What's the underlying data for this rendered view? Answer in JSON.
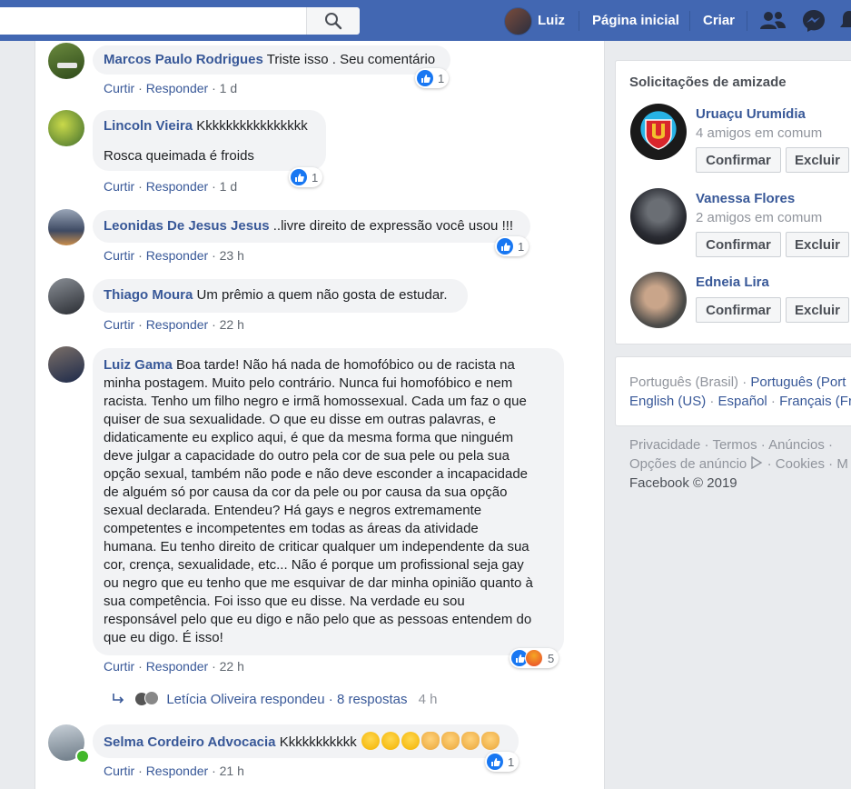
{
  "topbar": {
    "user_name": "Luiz",
    "home_label": "Página inicial",
    "create_label": "Criar",
    "colors": {
      "bar": "#4267b2"
    }
  },
  "comments": [
    {
      "author": "Marcos Paulo Rodrigues",
      "text": "Triste isso . Seu comentário",
      "like": "Curtir",
      "reply": "Responder",
      "time": "1 d",
      "reactions": "1"
    },
    {
      "author": "Lincoln Vieira",
      "text": "Kkkkkkkkkkkkkkkk",
      "text2": "Rosca queimada é froids",
      "like": "Curtir",
      "reply": "Responder",
      "time": "1 d",
      "reactions": "1"
    },
    {
      "author": "Leonidas De Jesus Jesus",
      "text": "..livre direito de expressão você usou !!!",
      "like": "Curtir",
      "reply": "Responder",
      "time": "23 h",
      "reactions": "1"
    },
    {
      "author": "Thiago Moura",
      "text": "Um prêmio a quem não gosta de estudar.",
      "like": "Curtir",
      "reply": "Responder",
      "time": "22 h"
    },
    {
      "author": "Luiz Gama",
      "text_lines": [
        "Boa tarde! Não há nada de homofóbico ou de racista na",
        "minha postagem. Muito pelo contrário. Nunca fui homofóbico e nem",
        "racista. Tenho um filho negro e irmã homossexual. Cada um faz o que",
        "quiser de sua sexualidade. O que eu disse em outras palavras, e",
        "didaticamente eu explico aqui, é que da mesma forma que ninguém",
        "deve julgar a capacidade do outro pela cor de sua pele ou pela sua",
        "opção sexual, também não pode e não deve esconder a incapacidade",
        "de alguém só por causa da cor da pele ou por causa da sua opção",
        "sexual declarada. Entendeu? Há gays e negros extremamente",
        "competentes e incompetentes em todas as áreas da atividade",
        "humana. Eu tenho direito de criticar qualquer um independente da sua",
        "cor, crença, sexualidade, etc... Não é porque um profissional seja gay",
        "ou negro que eu tenho que me esquivar de dar minha opinião quanto à",
        "sua competência. Foi isso que eu disse. Na verdade eu sou",
        "responsável pelo que eu digo e não pelo que as pessoas entendem do",
        "que eu digo. É isso!"
      ],
      "like": "Curtir",
      "reply": "Responder",
      "time": "22 h",
      "reactions": "5",
      "replies_summary": "Letícia Oliveira respondeu · 8 respostas",
      "replies_time": "4 h"
    },
    {
      "author": "Selma Cordeiro Advocacia",
      "text": "Kkkkkkkkkkk",
      "like": "Curtir",
      "reply": "Responder",
      "time": "21 h",
      "reactions": "1"
    }
  ],
  "friend_requests": {
    "title": "Solicitações de amizade",
    "confirm_label": "Confirmar",
    "delete_label": "Excluir",
    "items": [
      {
        "name": "Uruaçu Urumídia",
        "mutual": "4 amigos em comum"
      },
      {
        "name": "Vanessa Flores",
        "mutual": "2 amigos em comum"
      },
      {
        "name": "Edneia Lira"
      }
    ]
  },
  "languages": {
    "current": "Português (Brasil)",
    "sep": " · ",
    "l1": "Português (Port",
    "l2": "English (US)",
    "l3": "Español",
    "l4": "Français (Fr"
  },
  "footer": {
    "privacy": "Privacidade",
    "terms": "Termos",
    "ads": "Anúncios",
    "ad_choices": "Opções de anúncio",
    "cookies": "Cookies",
    "more": "M",
    "copyright": "Facebook © 2019"
  }
}
